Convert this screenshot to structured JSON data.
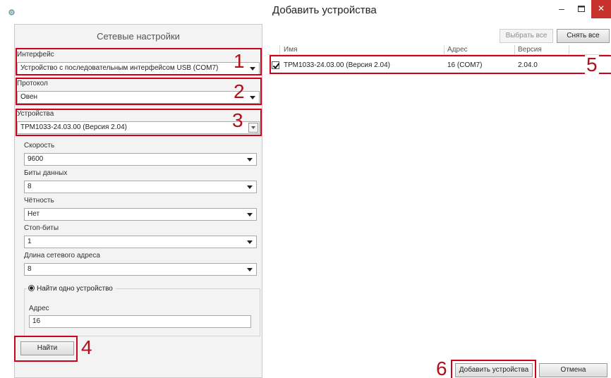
{
  "window": {
    "title": "Добавить устройства",
    "icon": "app-gear-icon"
  },
  "left_panel": {
    "header": "Сетевые настройки",
    "interface": {
      "label": "Интерфейс",
      "value": "Устройство с последовательным интерфейсом USB (COM7)"
    },
    "protocol": {
      "label": "Протокол",
      "value": "Овен"
    },
    "devices": {
      "label": "Устройства",
      "value": "ТРМ1033-24.03.00 (Версия 2.04)"
    },
    "speed": {
      "label": "Скорость",
      "value": "9600"
    },
    "data_bits": {
      "label": "Биты данных",
      "value": "8"
    },
    "parity": {
      "label": "Чётность",
      "value": "Нет"
    },
    "stop_bits": {
      "label": "Стоп-биты",
      "value": "1"
    },
    "address_length": {
      "label": "Длина сетевого адреса",
      "value": "8"
    },
    "find_mode": {
      "label": "Найти одно устройство"
    },
    "address": {
      "label": "Адрес",
      "value": "16"
    },
    "find_button": "Найти"
  },
  "right_panel": {
    "select_all": "Выбрать все",
    "deselect_all": "Снять все",
    "columns": [
      "Имя",
      "Адрес",
      "Версия"
    ],
    "rows": [
      {
        "checked": true,
        "name": "ТРМ1033-24.03.00 (Версия 2.04)",
        "address": "16 (COM7)",
        "version": "2.04.0"
      }
    ],
    "add_button": "Добавить устройства",
    "cancel_button": "Отмена"
  },
  "annotations": [
    "1",
    "2",
    "3",
    "4",
    "5",
    "6"
  ],
  "colors": {
    "annotation": "#d0021b",
    "close_button": "#c7312b",
    "panel_bg": "#f3f3f3"
  }
}
